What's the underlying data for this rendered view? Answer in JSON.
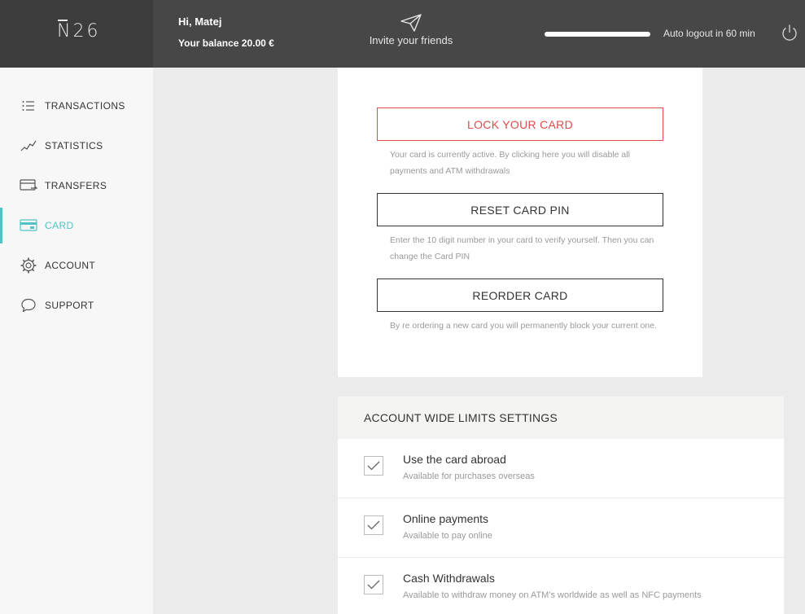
{
  "header": {
    "logo": "N26",
    "greeting": "Hi, Matej",
    "balance": "Your balance 20.00 €",
    "invite_label": "Invite your friends",
    "logout_text": "Auto logout in 60 min"
  },
  "sidebar": {
    "items": [
      {
        "label": "TRANSACTIONS",
        "icon": "list-icon"
      },
      {
        "label": "STATISTICS",
        "icon": "chart-line-icon"
      },
      {
        "label": "TRANSFERS",
        "icon": "transfer-card-icon"
      },
      {
        "label": "CARD",
        "icon": "card-icon",
        "active": true
      },
      {
        "label": "ACCOUNT",
        "icon": "gear-icon"
      },
      {
        "label": "SUPPORT",
        "icon": "chat-bubble-icon"
      }
    ]
  },
  "card_actions": {
    "lock_label": "LOCK YOUR CARD",
    "lock_desc": "Your card is currently active. By clicking here you will disable all payments and ATM withdrawals",
    "reset_label": "RESET CARD PIN",
    "reset_desc": "Enter the 10 digit number in your card to verify yourself. Then you can change the Card PIN",
    "reorder_label": "REORDER CARD",
    "reorder_desc": "By re ordering a new card you will permanently block your current one."
  },
  "limits": {
    "title": "ACCOUNT WIDE LIMITS SETTINGS",
    "rows": [
      {
        "title": "Use the card abroad",
        "subtitle": "Available for purchases overseas",
        "checked": true
      },
      {
        "title": "Online payments",
        "subtitle": "Available to pay online",
        "checked": true
      },
      {
        "title": "Cash Withdrawals",
        "subtitle": "Available to withdraw money on ATM's worldwide as well as NFC payments",
        "checked": true
      }
    ]
  },
  "colors": {
    "accent": "#52c3c4",
    "danger": "#e04a4a",
    "header_bg": "#474747"
  }
}
